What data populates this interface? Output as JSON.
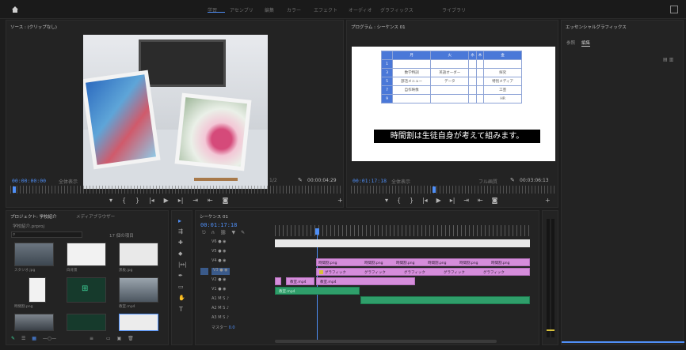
{
  "topbar": {
    "workspaces": [
      "学習",
      "アセンブリ",
      "編集",
      "カラー",
      "エフェクト",
      "オーディオ",
      "グラフィックス",
      "ライブラリ"
    ],
    "active_workspace": "編集",
    "home_icon": "home-icon",
    "expand_icon": "maximize-icon"
  },
  "source_monitor": {
    "title": "ソース : (クリップなし)",
    "timecode_left": "00:00:00:00",
    "fit": "全体表示",
    "quality": "1/2",
    "timecode_right": "00:00:04:29"
  },
  "program_monitor": {
    "title": "プログラム : シーケンス 01",
    "timecode_left": "00:01:17:18",
    "fit": "全体表示",
    "quality": "フル画質",
    "timecode_right": "00:03:06:13",
    "subtitle": "時間割は生徒自身が考えて組みます。",
    "table_headers": [
      "",
      "月",
      "火",
      "水",
      "木",
      "金"
    ],
    "table_rows": [
      [
        "1",
        "",
        "",
        "",
        "",
        ""
      ],
      [
        "2",
        "",
        "",
        "",
        "",
        ""
      ],
      [
        "3",
        "数学特訓",
        "英語オーダー",
        "",
        "",
        "探究"
      ],
      [
        "4",
        "",
        "",
        "",
        "",
        ""
      ],
      [
        "5",
        "部活メニュー",
        "データ",
        "",
        "",
        "特別メディア"
      ],
      [
        "6",
        "",
        "",
        "",
        "",
        ""
      ],
      [
        "7",
        "自作映像",
        "",
        "",
        "",
        "工芸"
      ],
      [
        "8",
        "",
        "",
        "",
        "",
        ""
      ],
      [
        "9",
        "",
        "",
        "",
        "",
        "HR"
      ],
      [
        "10",
        "",
        "",
        "",
        "",
        ""
      ]
    ]
  },
  "right_panel": {
    "title": "エッセンシャルグラフィックス",
    "tabs": [
      "参照",
      "編集"
    ]
  },
  "project_panel": {
    "title": "プロジェクト: 学校紹介",
    "title2": "メディアブラウザー",
    "project_name": "学校紹介.prproj",
    "item_count": "17 個の項目",
    "items": [
      {
        "name": "スタジオ.jpg",
        "dur": "4:29"
      },
      {
        "name": "白背景",
        "dur": "4:29"
      },
      {
        "name": "黒板.jpg",
        "dur": "4:29"
      },
      {
        "name": "時間割.png",
        "dur": "4:29"
      },
      {
        "name": "",
        "dur": ""
      },
      {
        "name": "教室.mp4",
        "dur": "1:05"
      },
      {
        "name": "",
        "dur": ""
      },
      {
        "name": "",
        "dur": ""
      },
      {
        "name": "",
        "dur": ""
      }
    ]
  },
  "tools": [
    "selection-tool-icon",
    "track-select-icon",
    "ripple-edit-icon",
    "razor-icon",
    "slip-icon",
    "pen-icon",
    "hand-icon",
    "type-tool-icon"
  ],
  "timeline": {
    "title": "シーケンス 01",
    "timecode": "00:01:17:18",
    "tracks": [
      "V6",
      "V5",
      "V4",
      "V3",
      "V2",
      "V1",
      "A1",
      "A2",
      "A3",
      "マスター"
    ],
    "master_value": "0.0",
    "clips_v3": [
      "時間割.png",
      "時間割.png",
      "時間割.png",
      "時間割.png",
      "時間割.png",
      "時間割.png",
      "時間割.png"
    ],
    "clips_v2": [
      "グラフィック",
      "グラフィック",
      "グラフィック",
      "グラフィック",
      "グラフィック",
      "グラフィック",
      "グラフィック"
    ],
    "clips_v1": [
      "教室.mp4",
      "教室.mp4"
    ],
    "audio_label": "教室.mp4"
  },
  "colors": {
    "accent": "#4f8ff7",
    "clip_pink": "#d58ddb",
    "clip_green": "#2f9e6a",
    "clip_yellow": "#d8c13a",
    "table_header": "#4a78d8"
  }
}
